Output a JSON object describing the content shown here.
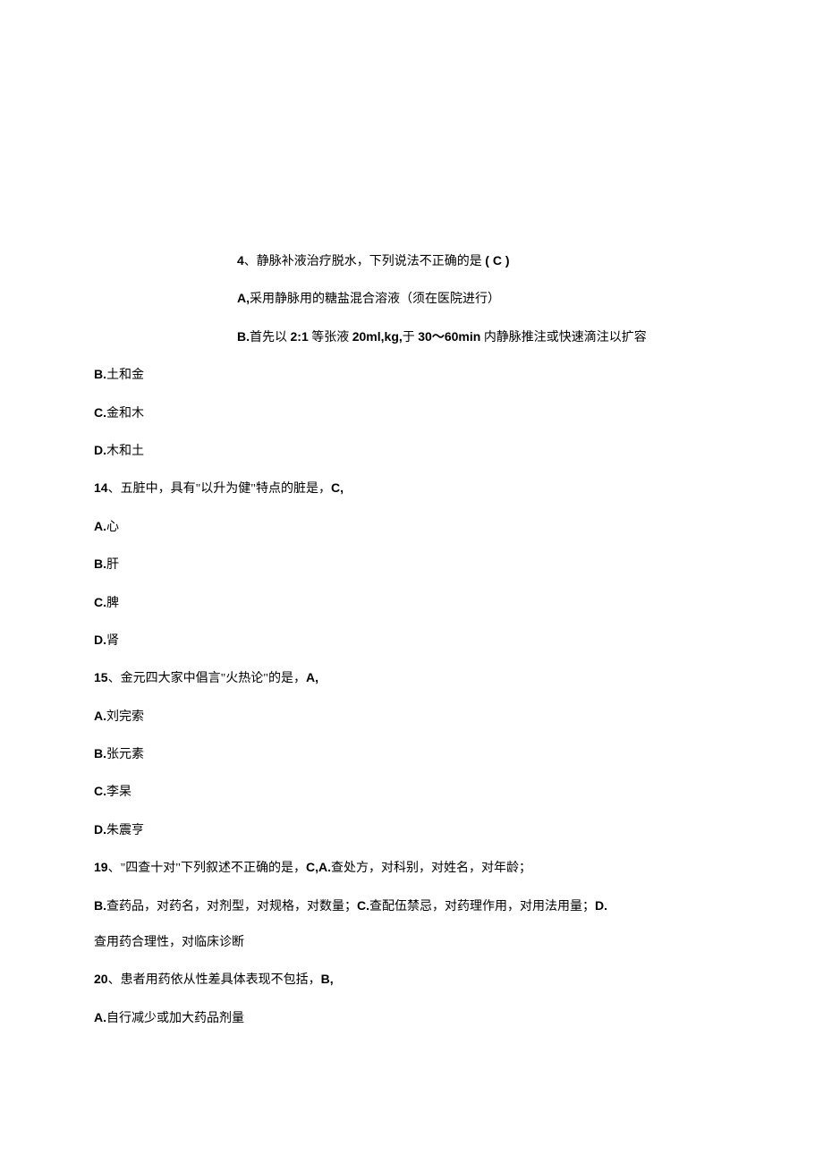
{
  "q4": {
    "number": "4",
    "text": "、静脉补液治疗脱水，下列说法不正确的是 ",
    "answer": "( C )",
    "optA_label": "A,",
    "optA_text": "采用静脉用的糖盐混合溶液（须在医院进行）",
    "optB_label": "B.",
    "optB_text_prefix": "首先以 ",
    "optB_bold1": "2:1",
    "optB_mid1": " 等张液 ",
    "optB_bold2": "20ml,kg,",
    "optB_mid2": "于 ",
    "optB_bold3": "30〜60min",
    "optB_suffix": " 内静脉推注或快速滴注以扩容"
  },
  "stray": {
    "B_label": "B.",
    "B_text": "土和金",
    "C_label": "C.",
    "C_text": "金和木",
    "D_label": "D.",
    "D_text": "木和土"
  },
  "q14": {
    "number": "14",
    "text": "、五脏中，具有\"以升为健\"特点的脏是，",
    "answer": "C,",
    "A_label": "A.",
    "A_text": "心",
    "B_label": "B.",
    "B_text": "肝",
    "C_label": "C.",
    "C_text": "脾",
    "D_label": "D.",
    "D_text": "肾"
  },
  "q15": {
    "number": "15",
    "text": "、金元四大家中倡言\"火热论\"的是，",
    "answer": "A,",
    "A_label": "A.",
    "A_text": "刘完索",
    "B_label": "B.",
    "B_text": "张元素",
    "C_label": "C.",
    "C_text": "李杲",
    "D_label": "D.",
    "D_text": "朱震亨"
  },
  "q19": {
    "number": "19",
    "text": "、\"四查十对\"下列叙述不正确的是，",
    "answer": "C,A.",
    "inline_text": "查处方，对科别，对姓名，对年龄；",
    "line2_B": "B.",
    "line2_Btext": "查药品，对药名，对剂型，对规格，对数量；",
    "line2_C": "C.",
    "line2_Ctext": "查配伍禁忌，对药理作用，对用法用量；",
    "line2_D": "D.",
    "line3_text": "查用药合理性，对临床诊断"
  },
  "q20": {
    "number": "20",
    "text": "、患者用药依从性差具体表现不包括，",
    "answer": "B,",
    "A_label": "A.",
    "A_text": "自行减少或加大药品剂量"
  }
}
